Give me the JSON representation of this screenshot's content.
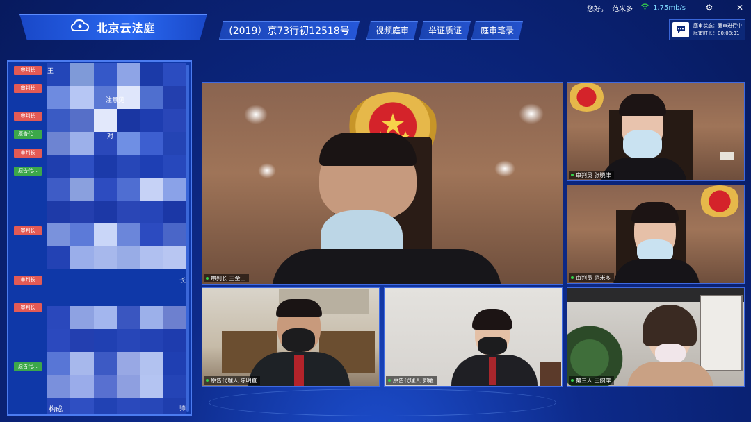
{
  "header": {
    "brand_title": "北京云法庭",
    "case_number": "(2019）京73行初12518号",
    "tabs": [
      {
        "label": "视频庭审"
      },
      {
        "label": "举证质证"
      },
      {
        "label": "庭审笔录"
      }
    ]
  },
  "user": {
    "greeting": "您好，",
    "name": "范米多",
    "network_speed": "1.75mb/s"
  },
  "status": {
    "state_line": "庭审状态：庭审进行中",
    "duration_line": "庭审时长：00:08:31"
  },
  "participants": [
    {
      "role": "审判长",
      "name_visible": "王"
    },
    {
      "role": "审判长"
    },
    {
      "role": "审判长"
    },
    {
      "role": "原告代..."
    },
    {
      "role": "审判长"
    },
    {
      "role": "原告代..."
    },
    {
      "role": "审判长"
    },
    {
      "role": "审判长"
    },
    {
      "role": "审判长"
    },
    {
      "role": "原告代..."
    }
  ],
  "participant_fragments": {
    "frag_1": "注意见",
    "frag_2": "对",
    "frag_3": "长",
    "frag_4": "构成",
    "frag_5": "师"
  },
  "videos": [
    {
      "label": "审判长 王金山"
    },
    {
      "label": "审判员 张晓津"
    },
    {
      "label": "审判员 范米多"
    },
    {
      "label": "原告代理人 陈明直"
    },
    {
      "label": "原告代理人 郭媛"
    },
    {
      "label": "第三人 王婉萍"
    }
  ],
  "colors": {
    "judge_tag": "#e35a55",
    "agent_tag": "#3ca84a",
    "online_dot": "#34d04a",
    "speed_text": "#7fd8ff"
  },
  "icons": {
    "brand": "cloud-icon",
    "wifi": "wifi-icon",
    "settings": "gear-icon",
    "minimize": "minimize-icon",
    "close": "close-icon",
    "chat": "chat-icon"
  }
}
